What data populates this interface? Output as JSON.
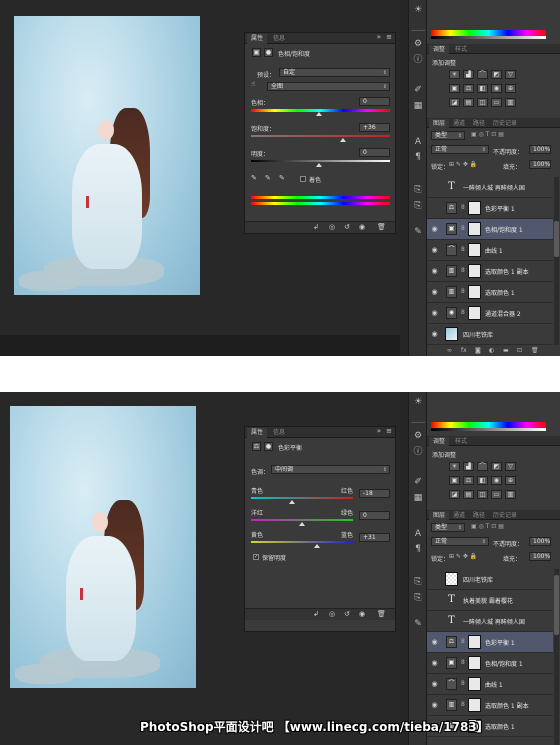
{
  "top": {
    "properties_panel": {
      "tabs": [
        "属性",
        "信息"
      ],
      "header": "色相/饱和度",
      "preset_label": "预设：",
      "preset_value": "自定",
      "channel_value": "全图",
      "hue_label": "色相：",
      "hue_value": "0",
      "saturation_label": "饱和度：",
      "saturation_value": "+36",
      "lightness_label": "明度：",
      "lightness_value": "0",
      "colorize_label": "着色"
    },
    "adjustments": {
      "tabs": [
        "调整",
        "样式"
      ],
      "add_label": "添加调整"
    },
    "layers": {
      "tabs": [
        "图层",
        "通道",
        "路径",
        "历史记录"
      ],
      "kind": "类型",
      "blend": "正常",
      "opacity_label": "不透明度：",
      "opacity_value": "100%",
      "lock_label": "锁定：",
      "fill_label": "填充：",
      "fill_value": "100%",
      "items": [
        {
          "name": "一眸倾人城 再眸倾人国",
          "kind": "text",
          "icon": "T",
          "visible": false,
          "selected": false
        },
        {
          "name": "色彩平衡 1",
          "kind": "adjustment",
          "icon": "⚖",
          "visible": false,
          "selected": false
        },
        {
          "name": "色相/饱和度 1",
          "kind": "adjustment",
          "icon": "▣",
          "visible": true,
          "selected": true
        },
        {
          "name": "曲线 1",
          "kind": "adjustment",
          "icon": "⌒",
          "visible": true,
          "selected": false
        },
        {
          "name": "选取颜色 1 副本",
          "kind": "adjustment",
          "icon": "▥",
          "visible": true,
          "selected": false
        },
        {
          "name": "选取颜色 1",
          "kind": "adjustment",
          "icon": "▥",
          "visible": true,
          "selected": false
        },
        {
          "name": "通道混合器 2",
          "kind": "adjustment",
          "icon": "◉",
          "visible": true,
          "selected": false
        },
        {
          "name": "四川老铁库",
          "kind": "image",
          "icon": "",
          "visible": true,
          "selected": false
        }
      ]
    }
  },
  "bottom": {
    "properties_panel": {
      "tabs": [
        "属性",
        "信息"
      ],
      "header": "色彩平衡",
      "tone_label": "色调：",
      "tone_value": "中间调",
      "cyan_label": "青色",
      "red_label": "红色",
      "cyan_red_value": "-18",
      "magenta_label": "洋红",
      "green_label": "绿色",
      "magenta_green_value": "0",
      "yellow_label": "黄色",
      "blue_label": "蓝色",
      "yellow_blue_value": "+31",
      "preserve_label": "保留明度"
    },
    "adjustments": {
      "tabs": [
        "调整",
        "样式"
      ],
      "add_label": "添加调整"
    },
    "layers": {
      "tabs": [
        "图层",
        "通道",
        "路径",
        "历史记录"
      ],
      "kind": "类型",
      "blend": "正常",
      "opacity_label": "不透明度：",
      "opacity_value": "100%",
      "lock_label": "锁定：",
      "fill_label": "填充：",
      "fill_value": "100%",
      "items": [
        {
          "name": "四川老铁库",
          "kind": "pattern",
          "icon": "",
          "visible": false,
          "selected": false
        },
        {
          "name": "执着美貌 霸着樱花",
          "kind": "text",
          "icon": "T",
          "visible": false,
          "selected": false
        },
        {
          "name": "一眸倾人城 再眸倾人国",
          "kind": "text",
          "icon": "T",
          "visible": false,
          "selected": false
        },
        {
          "name": "色彩平衡 1",
          "kind": "adjustment",
          "icon": "⚖",
          "visible": true,
          "selected": true
        },
        {
          "name": "色相/饱和度 1",
          "kind": "adjustment",
          "icon": "▣",
          "visible": true,
          "selected": false
        },
        {
          "name": "曲线 1",
          "kind": "adjustment",
          "icon": "⌒",
          "visible": true,
          "selected": false
        },
        {
          "name": "选取颜色 1 副本",
          "kind": "adjustment",
          "icon": "▥",
          "visible": true,
          "selected": false
        },
        {
          "name": "选取颜色 1",
          "kind": "adjustment",
          "icon": "▥",
          "visible": true,
          "selected": false
        }
      ]
    }
  },
  "watermark": "PhotoShop平面设计吧 【www.linecg.com/tieba/1783】",
  "colors": {
    "panel_bg": "#3a3a3a",
    "selected_row": "#51586d",
    "workspace": "#262626"
  }
}
